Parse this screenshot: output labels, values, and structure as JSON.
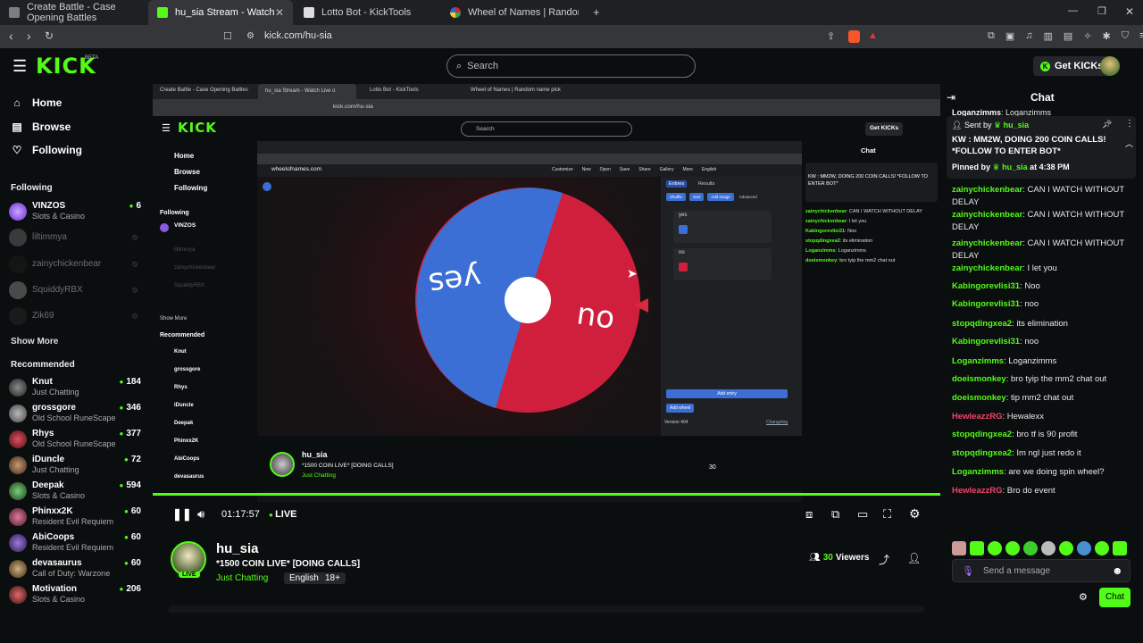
{
  "browser": {
    "tabs": [
      {
        "label": "Create Battle - Case Opening Battles",
        "active": false
      },
      {
        "label": "hu_sia Stream - Watch Live o",
        "active": true
      },
      {
        "label": "Lotto Bot - KickTools",
        "active": false
      },
      {
        "label": "Wheel of Names | Random name pick",
        "active": false
      }
    ],
    "url": "kick.com/hu-sia"
  },
  "header": {
    "logo": "KICK",
    "logo_beta": "BETA",
    "search_placeholder": "Search",
    "get_kicks": "Get KICKs"
  },
  "sidebar": {
    "nav": [
      {
        "label": "Home",
        "icon": "home-icon"
      },
      {
        "label": "Browse",
        "icon": "browse-icon"
      },
      {
        "label": "Following",
        "icon": "heart-icon"
      }
    ],
    "following_title": "Following",
    "following": [
      {
        "name": "VINZOS",
        "category": "Slots & Casino",
        "viewers": "6",
        "online": true
      },
      {
        "name": "liltimmya",
        "online": false
      },
      {
        "name": "zainychickenbear",
        "online": false
      },
      {
        "name": "SquiddyRBX",
        "online": false
      },
      {
        "name": "Zik69",
        "online": false
      }
    ],
    "show_more": "Show More",
    "recommended_title": "Recommended",
    "recommended": [
      {
        "name": "Knut",
        "category": "Just Chatting",
        "viewers": "184"
      },
      {
        "name": "grossgore",
        "category": "Old School RuneScape",
        "viewers": "346"
      },
      {
        "name": "Rhys",
        "category": "Old School RuneScape",
        "viewers": "377"
      },
      {
        "name": "iDuncle",
        "category": "Just Chatting",
        "viewers": "72"
      },
      {
        "name": "Deepak",
        "category": "Slots & Casino",
        "viewers": "594"
      },
      {
        "name": "Phinxx2K",
        "category": "Resident Evil Requiem",
        "viewers": "60"
      },
      {
        "name": "AbiCoops",
        "category": "Resident Evil Requiem",
        "viewers": "60"
      },
      {
        "name": "devasaurus",
        "category": "Call of Duty: Warzone",
        "viewers": "60"
      },
      {
        "name": "Motivation",
        "category": "Slots & Casino",
        "viewers": "206"
      }
    ]
  },
  "player": {
    "time": "01:17:57",
    "live_label": "LIVE",
    "progress": 1.0
  },
  "wheel": {
    "url": "wheelofnames.com",
    "segments": [
      "yes",
      "no"
    ],
    "colors": {
      "yes": "#3b6fd6",
      "no": "#d01f3c"
    },
    "toolbar": [
      "Customize",
      "New",
      "Open",
      "Save",
      "Share",
      "Gallery",
      "More",
      "English"
    ],
    "panel_tabs": [
      "Entries",
      "Results"
    ],
    "panel_buttons": [
      "Shuffle",
      "Sort",
      "Add image",
      "Advanced"
    ],
    "entries": [
      "yes",
      "no"
    ],
    "add_entry": "Add entry",
    "add_wheel": "Add wheel",
    "version": "Version 404",
    "changelog": "Changelog"
  },
  "stream": {
    "channel": "hu_sia",
    "title": "*1500 COIN LIVE* [DOING CALLS]",
    "category": "Just Chatting",
    "tags": [
      "English",
      "18+"
    ],
    "viewers": "30",
    "viewers_label": "Viewers",
    "live_badge": "LIVE"
  },
  "chat": {
    "title": "Chat",
    "pinned": {
      "sent_by_label": "Sent by",
      "sender": "hu_sia",
      "text": "KW : MM2W, DOING 200 COIN CALLS! *FOLLOW TO ENTER BOT*",
      "pinned_by_label": "Pinned by",
      "pinner": "hu_sia",
      "time": "at 4:38 PM"
    },
    "top_cut": {
      "user": "Loganzimms",
      "text": "Loganzimms"
    },
    "messages": [
      {
        "user": "zainychickenbear",
        "text": "CAN I WATCH WITHOUT DELAY",
        "color": "#53fc18"
      },
      {
        "user": "zainychickenbear",
        "text": "CAN I WATCH WITHOUT DELAY",
        "color": "#53fc18"
      },
      {
        "user": "zainychickenbear",
        "text": "CAN I WATCH WITHOUT DELAY",
        "color": "#53fc18"
      },
      {
        "user": "zainychickenbear",
        "text": "I let you",
        "color": "#53fc18"
      },
      {
        "user": "Kabingorevlisi31",
        "text": "Noo",
        "color": "#53fc18"
      },
      {
        "user": "Kabingorevlisi31",
        "text": "noo",
        "color": "#53fc18"
      },
      {
        "user": "stopqdingxea2",
        "text": "its elimination",
        "color": "#53fc18"
      },
      {
        "user": "Kabingorevlisi31",
        "text": "noo",
        "color": "#53fc18"
      },
      {
        "user": "Loganzimms",
        "text": "Loganzimms",
        "color": "#53fc18"
      },
      {
        "user": "doeismonkey",
        "text": "bro tyip the mm2 chat out",
        "color": "#53fc18"
      },
      {
        "user": "doeismonkey",
        "text": "tip mm2 chat out",
        "color": "#53fc18"
      },
      {
        "user": "HewleazzRG",
        "text": "Hewalexx",
        "color": "#f0466b"
      },
      {
        "user": "stopqdingxea2",
        "text": "bro tf is 90 profit",
        "color": "#53fc18"
      },
      {
        "user": "stopqdingxea2",
        "text": "Im ngl just redo it",
        "color": "#53fc18"
      },
      {
        "user": "Loganzimms",
        "text": "are we doing spin wheel?",
        "color": "#53fc18"
      },
      {
        "user": "HewleazzRG",
        "text": "Bro do event",
        "color": "#f0466b"
      }
    ],
    "input_placeholder": "Send a message",
    "send_label": "Chat"
  },
  "colors": {
    "accent": "#53fc18",
    "bg": "#0b0e0f"
  }
}
